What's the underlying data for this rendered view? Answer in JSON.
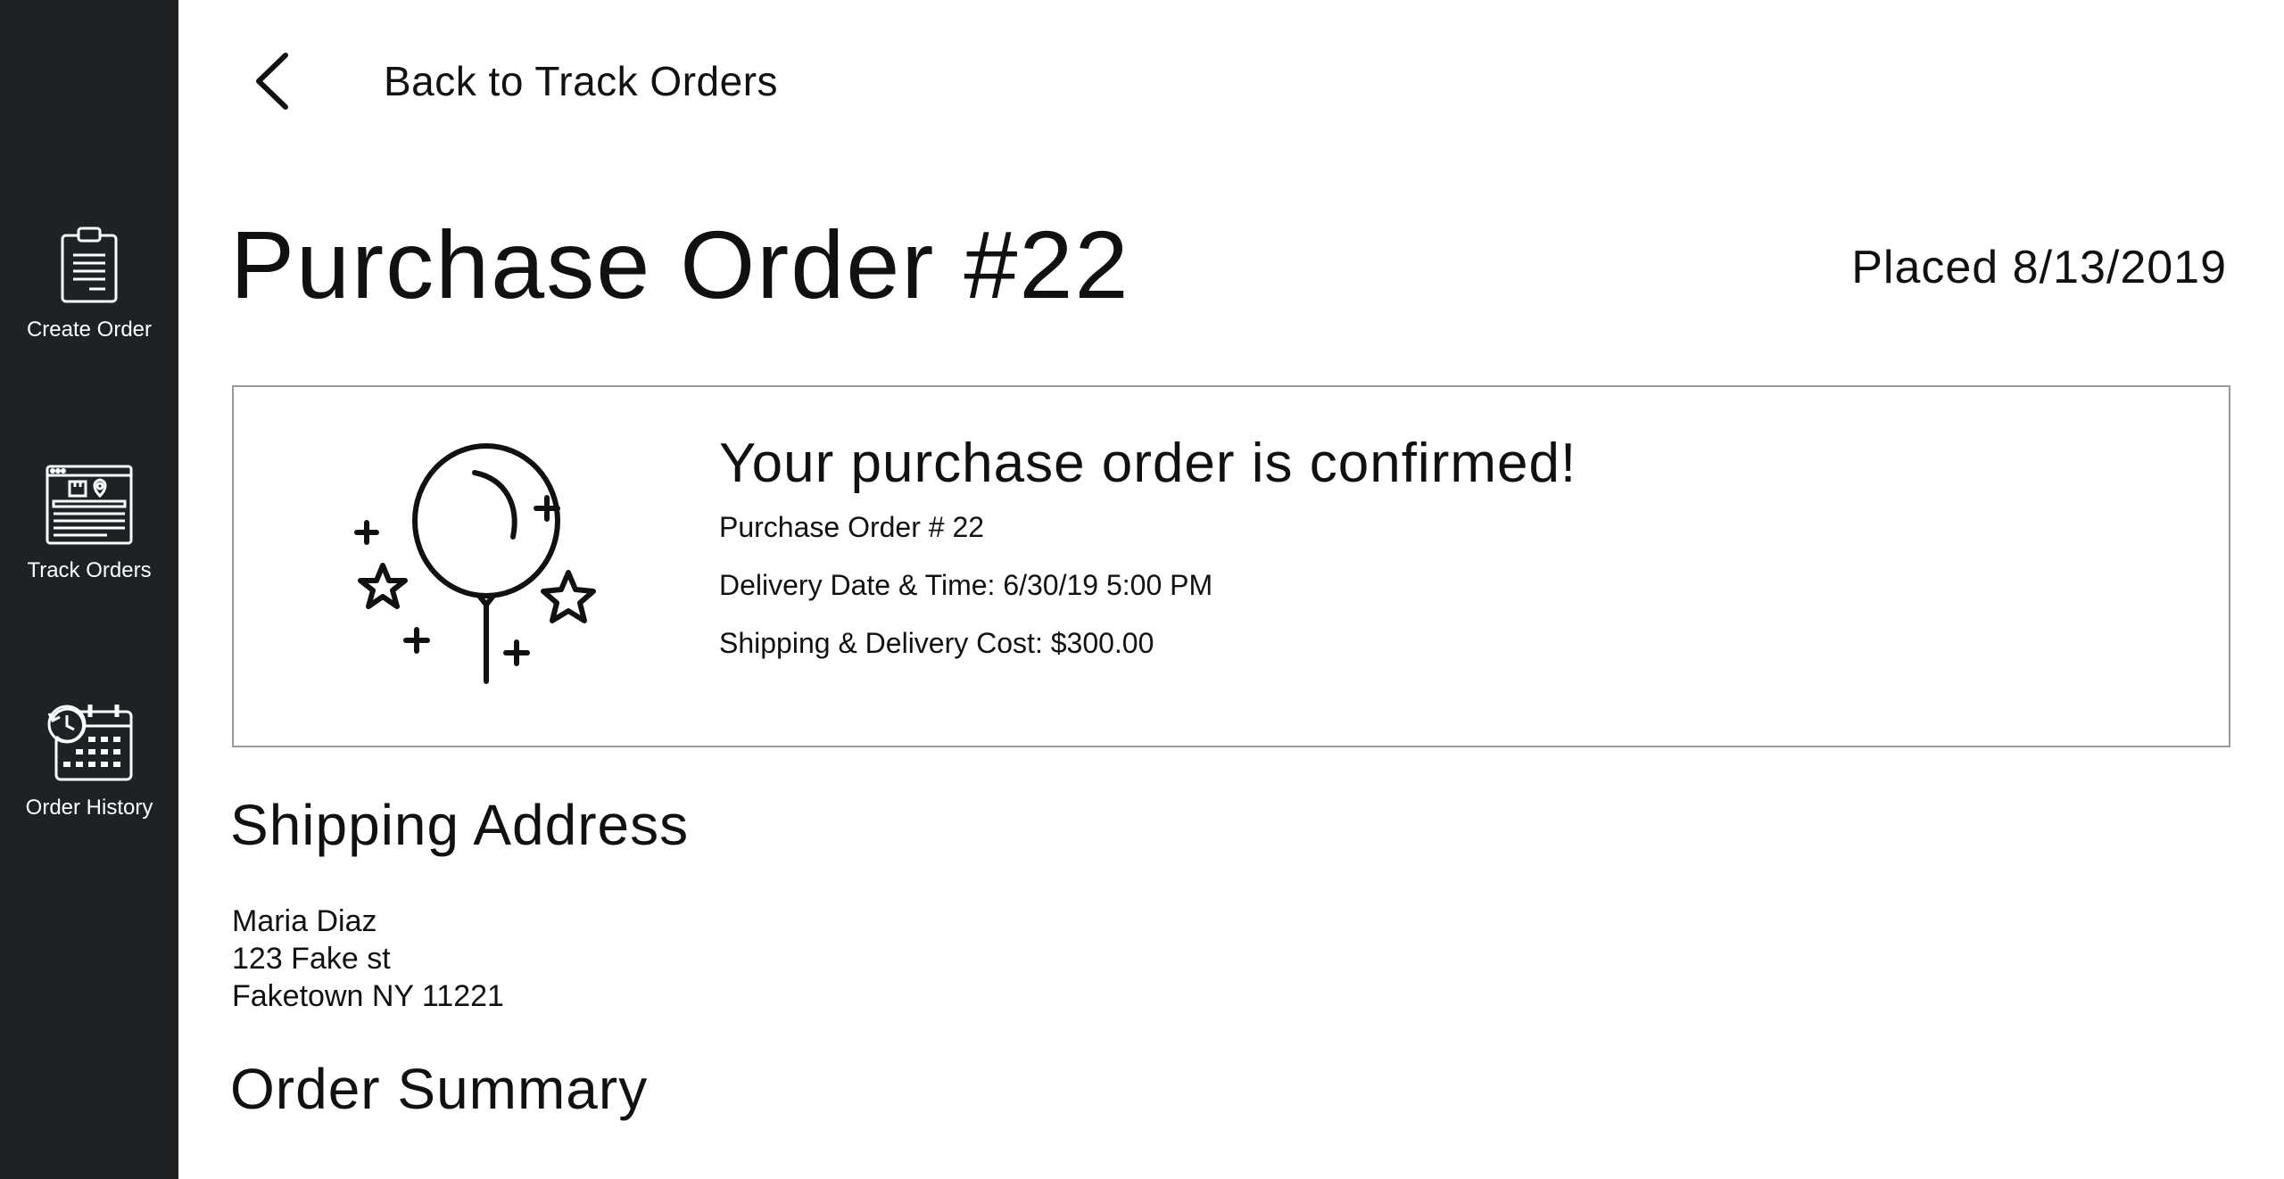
{
  "sidebar": {
    "items": [
      {
        "label": "Create Order",
        "icon": "clipboard-icon"
      },
      {
        "label": "Track Orders",
        "icon": "track-browser-icon"
      },
      {
        "label": "Order History",
        "icon": "calendar-history-icon"
      }
    ]
  },
  "header": {
    "back_label": "Back to Track Orders",
    "title": "Purchase Order #22",
    "placed": "Placed 8/13/2019"
  },
  "confirmation": {
    "icon": "balloon-stars-icon",
    "heading": "Your purchase order is confirmed!",
    "order_number": "Purchase Order # 22",
    "delivery": "Delivery Date & Time: 6/30/19 5:00 PM",
    "cost": "Shipping & Delivery Cost: $300.00"
  },
  "shipping": {
    "heading": "Shipping Address",
    "name": "Maria Diaz",
    "street": "123 Fake st",
    "city_line": "Faketown NY 11221"
  },
  "summary": {
    "heading": "Order Summary"
  },
  "colors": {
    "sidebar_bg": "#1f2225",
    "text": "#111111",
    "box_border": "#9a9a9a"
  }
}
